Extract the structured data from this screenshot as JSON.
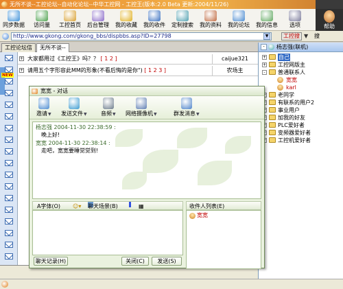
{
  "window": {
    "title": "无所不谈--工控论坛--自动化论坛--中华工控网 - 工控王(版本:2.0 Beta 更新:2004/11/26)"
  },
  "toolbar": {
    "buttons": [
      {
        "label": "同步数据",
        "icon": "sync-icon",
        "color": "#3a8fd8"
      },
      {
        "label": "访问量",
        "icon": "visits-icon",
        "color": "#4aa04a"
      },
      {
        "label": "工控首页",
        "icon": "home-icon",
        "color": "#d8a030"
      },
      {
        "label": "后台管理",
        "icon": "admin-icon",
        "color": "#8a6ac8"
      },
      {
        "label": "我的收藏",
        "icon": "favorites-icon",
        "color": "#e0b020"
      },
      {
        "label": "我的收件",
        "icon": "inbox-icon",
        "color": "#3a70c0"
      },
      {
        "label": "定制搜索",
        "icon": "search-icon",
        "color": "#50a0b0"
      },
      {
        "label": "我的资料",
        "icon": "profile-icon",
        "color": "#c06a40"
      },
      {
        "label": "我的论坛",
        "icon": "forum-icon",
        "color": "#4a8ad0"
      },
      {
        "label": "我的信息",
        "icon": "message-icon",
        "color": "#60a860"
      },
      {
        "label": "选项",
        "icon": "options-icon",
        "color": "#7a7a9a"
      }
    ],
    "help_label": "帮助"
  },
  "address": {
    "url": "http://www.gkong.com/gkong_bbs/dispbbs.asp?ID=27798",
    "search_label": "工控搜",
    "extra_label": "搜"
  },
  "tabs": [
    "工控论坛信",
    "无所不谈--"
  ],
  "forum": {
    "rows": [
      {
        "title": "大家都用过《工控王》吗？？",
        "pages": "[ 1 2 ]",
        "author": "caijue321"
      },
      {
        "title": "请用五个字形容此MM的形象(不看后悔的是你\")",
        "pages": "[ 1 2 3 ]",
        "author": "农场主"
      }
    ],
    "new_badge": "NEW"
  },
  "buddy": {
    "header": "杨志强(联机)",
    "nodes": [
      {
        "label": "自己",
        "level": 0,
        "kind": "folder",
        "expander": "+",
        "selected": true
      },
      {
        "label": "工控网版主",
        "level": 0,
        "kind": "folder",
        "expander": "+"
      },
      {
        "label": "普通联系人",
        "level": 0,
        "kind": "folder",
        "expander": "-"
      },
      {
        "label": "宽宽",
        "level": 1,
        "kind": "person",
        "red": true
      },
      {
        "label": "karl",
        "level": 1,
        "kind": "person",
        "red": true
      },
      {
        "label": "老同学",
        "level": 0,
        "kind": "folder",
        "expander": "+"
      },
      {
        "label": "有联系的用户2",
        "level": 0,
        "kind": "folder",
        "expander": "+"
      },
      {
        "label": "事业用户",
        "level": 0,
        "kind": "folder",
        "expander": "+"
      },
      {
        "label": "加我的好友",
        "level": 0,
        "kind": "folder",
        "expander": "+"
      },
      {
        "label": "PLC爱好者",
        "level": 0,
        "kind": "folder",
        "expander": "+"
      },
      {
        "label": "变频器爱好者",
        "level": 0,
        "kind": "folder",
        "expander": "+"
      },
      {
        "label": "工控机爱好者",
        "level": 0,
        "kind": "folder",
        "expander": "+"
      }
    ]
  },
  "chat": {
    "title": "宽宽 - 对话",
    "tools": [
      {
        "label": "邀请",
        "icon": "invite-icon",
        "color": "#4a8ad0",
        "dd": true
      },
      {
        "label": "发送文件",
        "icon": "send-file-icon",
        "color": "#3a9ad0",
        "dd": true
      },
      {
        "label": "音频",
        "icon": "microphone-icon",
        "color": "#6a7a8a",
        "dd": true
      },
      {
        "label": "网络摄像机",
        "icon": "webcam-icon",
        "color": "#5a7ab0",
        "dd": true
      },
      {
        "label": "群发消息",
        "icon": "broadcast-icon",
        "color": "#4a80c8",
        "dd": true
      }
    ],
    "messages": [
      {
        "header": "杨志强 2004-11-30 22:38:59 :",
        "body": "晚上好!"
      },
      {
        "header": "宽宽 2004-11-30 22:38:14 :",
        "body": "走吧，宽宽要睡觉觉到!"
      }
    ],
    "input_toolbar": {
      "font_label": "A字体(O)",
      "scene_label": "聊天场景(B)"
    },
    "recipients_header": "收件人列表(E)",
    "recipients": [
      "宽宽"
    ],
    "buttons": {
      "history": "聊天记录(H)",
      "close": "关闭(C)",
      "send": "发送(S)"
    }
  }
}
